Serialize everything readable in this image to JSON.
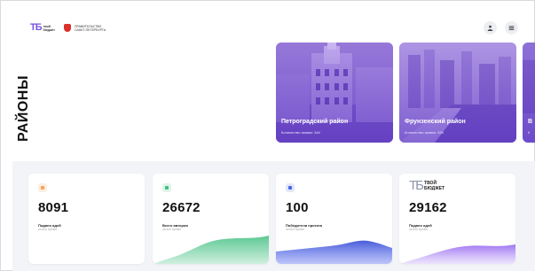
{
  "header": {
    "tb_logo": {
      "mark": "TБ",
      "line1": "твой",
      "line2": "бюджет"
    },
    "gov_logo": {
      "line1": "ПРАВИТЕЛЬСТВО",
      "line2": "САНКТ-ПЕТЕРБУРГА"
    },
    "buttons": [
      {
        "icon": "user-icon"
      },
      {
        "icon": "menu-icon"
      }
    ]
  },
  "page_title": "РАЙОНЫ",
  "districts": [
    {
      "name": "Петроградский район",
      "count": "Количество заявок: 344"
    },
    {
      "name": "Фрунзенский район",
      "count": "Количество заявок: 328"
    },
    {
      "name": "В",
      "count": "К"
    }
  ],
  "stats": [
    {
      "value": "8091",
      "label": "Подано идей",
      "sub": "за все время",
      "icon_color": "#f6a35c",
      "wave_color": "#f6a35c",
      "icon": "lightbulb-icon"
    },
    {
      "value": "26672",
      "label": "Всего авторов",
      "sub": "за все время",
      "icon_color": "#3fbf7f",
      "wave_color": "#3fbf7f",
      "icon": "people-icon"
    },
    {
      "value": "100",
      "label": "Победители проекта",
      "sub": "за все время",
      "icon_color": "#4a63e6",
      "wave_color": "#4a63e6",
      "icon": "trophy-icon"
    },
    {
      "value": "29162",
      "label": "Подано идей",
      "sub": "за все время",
      "icon_color": "#8f5cf0",
      "wave_color": "#8f5cf0",
      "icon": "tb-logo"
    }
  ],
  "stats_logo": {
    "mark": "TБ",
    "line1": "ТВОЙ",
    "line2": "БЮДЖЕТ"
  },
  "colors": {
    "accent": "#7b54e0",
    "band": "#f3f4f7"
  }
}
